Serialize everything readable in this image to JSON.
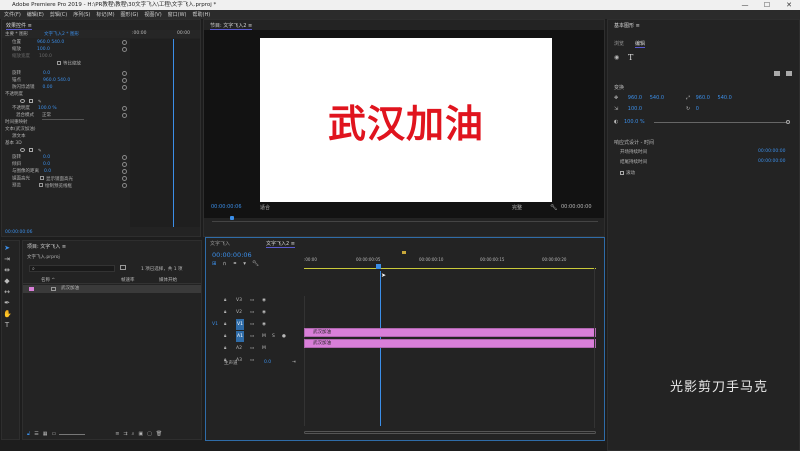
{
  "app": {
    "title": "Adobe Premiere Pro 2019 - H:\\PR教程\\教程\\30文字飞入\\工程\\文字飞入.prproj *"
  },
  "window": {
    "minimize": "—",
    "maximize": "☐",
    "close": "✕"
  },
  "menu": [
    "文件(F)",
    "编辑(E)",
    "剪辑(C)",
    "序列(S)",
    "标记(M)",
    "图形(G)",
    "视图(V)",
    "窗口(W)",
    "帮助(H)"
  ],
  "effect_controls": {
    "tab": "效果控件 ≡",
    "header_main": "主要 * 图形",
    "header_clip": "文字飞入2 * 图形",
    "time_start": ":00:00",
    "time_end": "00:00",
    "rows": [
      {
        "label": "位置",
        "value": "960.0  540.0"
      },
      {
        "label": "缩放",
        "value": "100.0"
      },
      {
        "label": "缩放宽度",
        "value": "100.0"
      },
      {
        "label": "等比缩放",
        "value": ""
      },
      {
        "label": "旋转",
        "value": "0.0"
      },
      {
        "label": "锚点",
        "value": "960.0  540.0"
      },
      {
        "label": "防闪烁滤镜",
        "value": "0.00"
      },
      {
        "label": "不透明度",
        "value": ""
      },
      {
        "label": "不透明度",
        "value": "100.0 %"
      },
      {
        "label": "混合模式",
        "value": "正常"
      },
      {
        "label": "时间重映射",
        "value": ""
      },
      {
        "label": "文本(武汉加油)",
        "value": ""
      },
      {
        "label": "源文本",
        "value": ""
      },
      {
        "label": "基本 3D",
        "value": ""
      },
      {
        "label": "旋转",
        "value": "0.0"
      },
      {
        "label": "倾斜",
        "value": "0.0"
      },
      {
        "label": "与图像的距离",
        "value": "0.0"
      },
      {
        "label": "镜面高光",
        "value": "显示镜面高光"
      },
      {
        "label": "预览",
        "value": "绘制预览线框"
      }
    ],
    "footer_time": "00:00:00:06"
  },
  "program": {
    "tab": "节目: 文字飞入2 ≡",
    "video_text": "武汉加油",
    "text_color": "#e0141e",
    "timecode": "00:00:00:06",
    "fit": "适合",
    "quality": "完整",
    "duration": "00:00:00:00"
  },
  "essential_graphics": {
    "tab": "基本图形 ≡",
    "subtab_browse": "浏览",
    "subtab_edit": "编辑",
    "section_align": "变换",
    "x": "960.0",
    "y": "540.0",
    "ax": "960.0",
    "ay": "540.0",
    "scale": "100.0",
    "rotation": "0",
    "opacity": "100.0 %",
    "responsive_title": "响应式设计 - 时间",
    "intro_label": "开场持续时间",
    "intro_value": "00:00:00:00",
    "outro_label": "结尾持续时间",
    "outro_value": "00:00:00:00",
    "roll_label": "滚动"
  },
  "project": {
    "tab": "项目: 文字飞入 ≡",
    "file": "文字飞入.prproj",
    "count": "1 项已选择，共 1 项",
    "col_name": "名称 ^",
    "col_fps": "帧速率",
    "col_start": "媒体开始",
    "item": "武汉加油"
  },
  "timeline": {
    "tab1": "文字飞入",
    "tab2": "文字飞入2 ≡",
    "timecode": "00:00:00:06",
    "ruler": [
      ":00:00",
      "00:00:00:05",
      "00:00:00:10",
      "00:00:00:15",
      "00:00:00:20"
    ],
    "tracks": [
      "V3",
      "V2",
      "V1",
      "A1",
      "A2",
      "A3"
    ],
    "master": "主声道",
    "master_value": "0.0",
    "clip_top": "武汉加油",
    "clip_bottom": "武汉加油"
  },
  "watermark": "光影剪刀手马克"
}
